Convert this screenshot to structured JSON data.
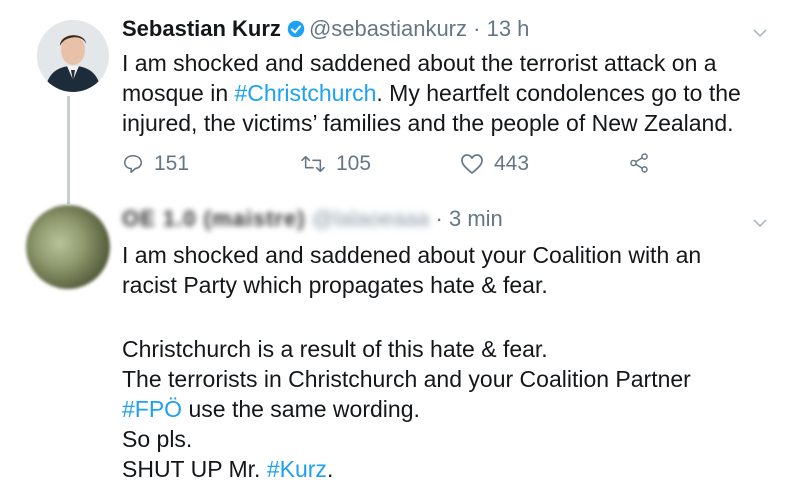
{
  "tweet1": {
    "author_name": "Sebastian Kurz",
    "handle": "@sebastiankurz",
    "separator": " · ",
    "time": "13 h",
    "lines": [
      {
        "pre": "I am shocked and saddened about the terrorist attack on a",
        "tag": "",
        "post": ""
      },
      {
        "pre": "mosque in ",
        "tag": "#Christchurch",
        "post": ". My heartfelt condolences go to the"
      },
      {
        "pre": "injured, the victims’ families and the people of New Zealand.",
        "tag": "",
        "post": ""
      }
    ],
    "replies": "151",
    "retweets": "105",
    "likes": "443",
    "accent_color": "#1da1f2"
  },
  "tweet2": {
    "author_name": "OE 1.0 (maistre)",
    "handle": "@lalaoeaaa",
    "separator": " · ",
    "time": "3 min",
    "para1": [
      "I am shocked and saddened about your Coalition with an",
      "racist Party which propagates hate & fear."
    ],
    "para2": [
      {
        "pre": "Christchurch is a result of this hate & fear.",
        "tag": "",
        "post": ""
      },
      {
        "pre": "The terrorists in Christchurch and your Coalition Partner",
        "tag": "",
        "post": ""
      },
      {
        "pre": "",
        "tag": "#FPÖ",
        "post": " use the same wording."
      },
      {
        "pre": "So pls.",
        "tag": "",
        "post": ""
      },
      {
        "pre": "SHUT UP Mr. ",
        "tag": "#Kurz",
        "post": "."
      }
    ]
  },
  "icons": {
    "verified": "verified-badge-icon",
    "reply": "reply-icon",
    "retweet": "retweet-icon",
    "like": "heart-icon",
    "share": "share-icon",
    "more": "chevron-down-icon"
  }
}
